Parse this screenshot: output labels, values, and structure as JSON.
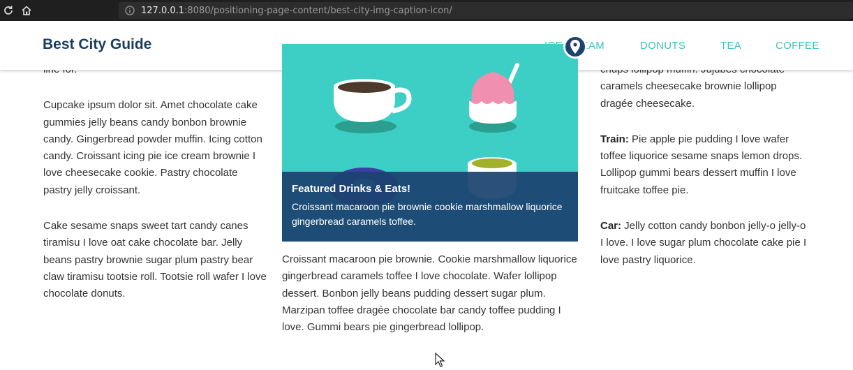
{
  "browser": {
    "url_host": "127.0.0.1",
    "url_rest": ":8080/positioning-page-content/best-city-img-caption-icon/",
    "reload_icon": "reload-icon",
    "home_icon": "home-icon",
    "info_icon": "info-icon"
  },
  "header": {
    "title": "Best City Guide",
    "nav": {
      "icecream": "ICE CREAM",
      "donuts": "DONUTS",
      "tea": "TEA",
      "coffee": "COFFEE"
    }
  },
  "colors": {
    "accent": "#3cc3bd",
    "brand": "#1a3c5e",
    "caption_bg": "#1b4370",
    "figure_bg": "#3dcfc5"
  },
  "left_column": {
    "p0": "line for.",
    "p1": "Cupcake ipsum dolor sit. Amet chocolate cake gummies jelly beans candy bonbon brownie candy. Gingerbread powder muffin. Icing cotton candy. Croissant icing pie ice cream brownie I love cheesecake cookie. Pastry chocolate pastry jelly croissant.",
    "p2": "Cake sesame snaps sweet tart candy canes tiramisu I love oat cake chocolate bar. Jelly beans pastry brownie sugar plum pastry bear claw tiramisu tootsie roll. Tootsie roll wafer I love chocolate donuts."
  },
  "figure": {
    "caption_title": "Featured Drinks & Eats!",
    "caption_text": "Croissant macaroon pie brownie cookie marshmallow liquorice gingerbread caramels toffee.",
    "pin_icon": "map-pin-icon"
  },
  "middle_column": {
    "p1": "Croissant macaroon pie brownie. Cookie marshmallow liquorice gingerbread caramels toffee I love chocolate. Wafer lollipop dessert. Bonbon jelly beans pudding dessert sugar plum. Marzipan toffee dragée chocolate bar candy toffee pudding I love. Gummi bears pie gingerbread lollipop."
  },
  "right_column": {
    "p0": "chups lollipop muffin. Jujubes chocolate caramels cheesecake brownie lollipop dragée cheesecake.",
    "train_label": "Train:",
    "train_text": " Pie apple pie pudding I love wafer toffee liquorice sesame snaps lemon drops. Lollipop gummi bears dessert muffin I love fruitcake toffee pie.",
    "car_label": "Car:",
    "car_text": " Jelly cotton candy bonbon jelly-o jelly-o I love. I love sugar plum chocolate cake pie I love pastry liquorice."
  }
}
